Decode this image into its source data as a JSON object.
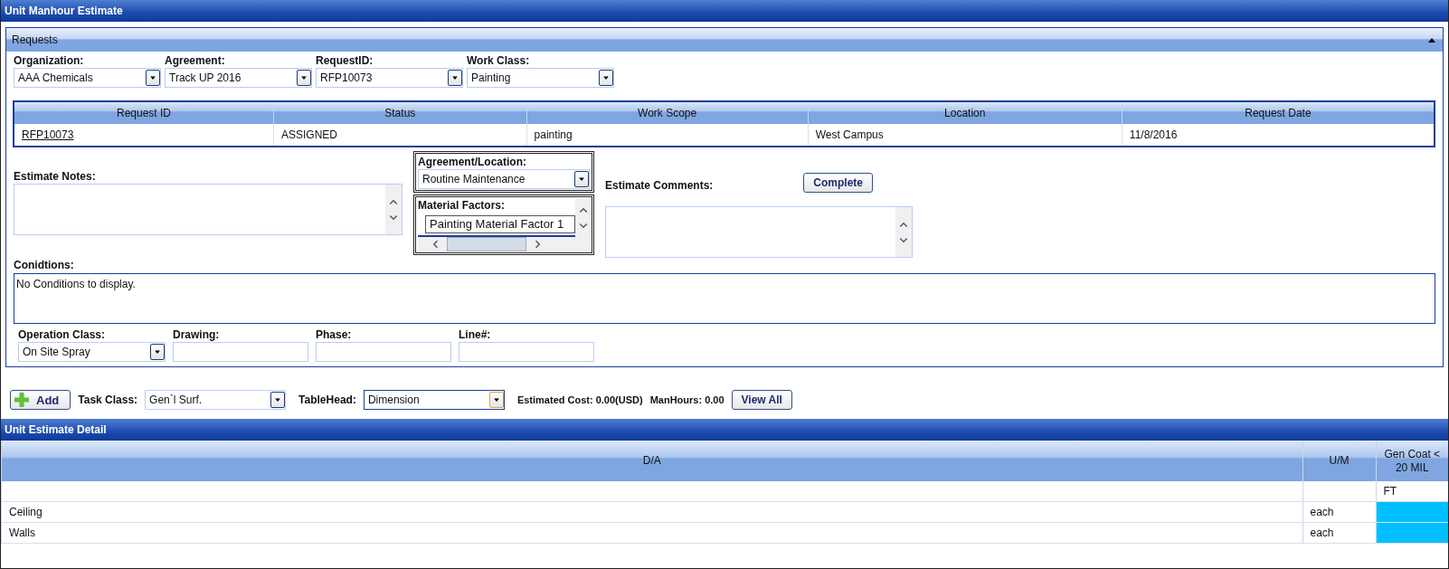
{
  "window": {
    "title": "Unit Manhour Estimate"
  },
  "requests": {
    "title": "Requests",
    "expanded": true,
    "filters": [
      {
        "label": "Organization:",
        "value": "AAA Chemicals"
      },
      {
        "label": "Agreement:",
        "value": "Track UP 2016"
      },
      {
        "label": "RequestID:",
        "value": "RFP10073"
      },
      {
        "label": "Work Class:",
        "value": "Painting"
      }
    ],
    "table": {
      "columns": [
        "Request ID",
        "Status",
        "Work Scope",
        "Location",
        "Request Date"
      ],
      "rows": [
        {
          "cells": [
            "RFP10073",
            "ASSIGNED",
            "painting",
            "West Campus",
            "11/8/2016"
          ]
        }
      ]
    },
    "estimate_notes": {
      "label": "Estimate Notes:"
    },
    "agreement_location": {
      "label": "Agreement/Location:",
      "value": "Routine Maintenance"
    },
    "material_factors": {
      "label": "Material Factors:",
      "items": [
        "Painting Material Factor 1"
      ]
    },
    "estimate_comments": {
      "label": "Estimate Comments:"
    },
    "complete_button": "Complete",
    "conditions": {
      "label": "Conidtions:",
      "text": "No Conditions to display."
    },
    "fields": [
      {
        "kind": "dropdown",
        "label": "Operation Class:",
        "value": "On Site Spray"
      },
      {
        "kind": "text",
        "label": "Drawing:"
      },
      {
        "kind": "text",
        "label": "Phase:"
      },
      {
        "kind": "text",
        "label": "Line#:"
      }
    ]
  },
  "toolbar": {
    "add_button": "Add",
    "task_class": {
      "label": "Task Class:",
      "value": "Gen`l Surf.",
      "focused": false
    },
    "table_head": {
      "label": "TableHead:",
      "value": "Dimension",
      "focused": true
    },
    "estimated_cost": "Estimated Cost: 0.00(USD)",
    "manhours": "ManHours: 0.00",
    "view_all_button": "View All"
  },
  "detail": {
    "title": "Unit Estimate Detail",
    "columns": [
      "D/A",
      "U/M",
      "Gen Coat < 20 MIL"
    ],
    "rows": [
      {
        "gen_coat": "FT",
        "highlighted": false
      },
      {
        "da": "Ceiling",
        "um": "each",
        "highlighted": true
      },
      {
        "da": "Walls",
        "um": "each",
        "highlighted": true
      }
    ]
  }
}
